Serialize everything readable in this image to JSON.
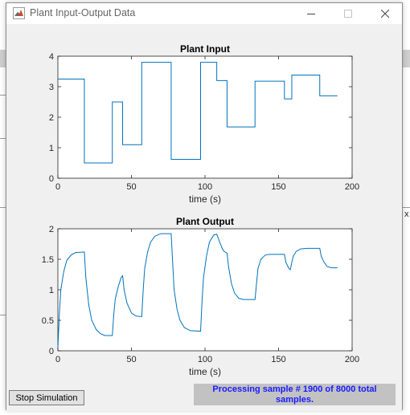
{
  "window": {
    "title": "Plant Input-Output Data",
    "controls": {
      "minimize": "minimize-icon",
      "maximize": "maximize-icon",
      "close": "close-icon"
    }
  },
  "status_text": "Processing sample # 1900 of 8000 total samples.",
  "stop_label": "Stop Simulation",
  "colors": {
    "line": "#0072bd",
    "status_text": "#1a1aff",
    "status_bg": "#c2c2c2"
  },
  "chart_data": [
    {
      "type": "line",
      "title": "Plant Input",
      "xlabel": "time (s)",
      "ylabel": "",
      "xlim": [
        0,
        200
      ],
      "ylim": [
        0,
        4
      ],
      "xticks": [
        0,
        50,
        100,
        150,
        200
      ],
      "yticks": [
        0,
        1,
        2,
        3,
        4
      ],
      "ytick_labels": [
        "0",
        "1",
        "2",
        "3",
        "4"
      ],
      "grid": false,
      "series": [
        {
          "step": true,
          "x": [
            0,
            18,
            37,
            44,
            57,
            77,
            97,
            108,
            115,
            134,
            154,
            159,
            178,
            190
          ],
          "y": [
            3.25,
            0.5,
            2.5,
            1.1,
            3.8,
            0.62,
            3.8,
            3.2,
            1.68,
            3.18,
            2.6,
            3.38,
            2.7,
            2.7
          ]
        }
      ]
    },
    {
      "type": "line",
      "title": "Plant Output",
      "xlabel": "time (s)",
      "ylabel": "",
      "xlim": [
        0,
        200
      ],
      "ylim": [
        0,
        2
      ],
      "xticks": [
        0,
        50,
        100,
        150,
        200
      ],
      "yticks": [
        0,
        0.5,
        1,
        1.5,
        2
      ],
      "ytick_labels": [
        "0",
        "0.5",
        "1",
        "1.5",
        "2"
      ],
      "grid": false,
      "series": [
        {
          "x": [
            0,
            1,
            2,
            4,
            6,
            9,
            12,
            18,
            19,
            21,
            23,
            26,
            29,
            32,
            37,
            38,
            39,
            41,
            43,
            44,
            45,
            47,
            50,
            53,
            57,
            58,
            59,
            61,
            63,
            66,
            70,
            77,
            78,
            79,
            81,
            83,
            86,
            90,
            97,
            98,
            99,
            101,
            103,
            106,
            108,
            110,
            112,
            113,
            115,
            116,
            118,
            120,
            123,
            126,
            130,
            134,
            135,
            136,
            138,
            141,
            144,
            149,
            154,
            155,
            157,
            158,
            159,
            160,
            162,
            165,
            170,
            178,
            179,
            181,
            183,
            186,
            190
          ],
          "y": [
            0.05,
            0.6,
            1.0,
            1.3,
            1.48,
            1.57,
            1.61,
            1.62,
            1.2,
            0.75,
            0.5,
            0.35,
            0.28,
            0.25,
            0.25,
            0.6,
            0.85,
            1.05,
            1.2,
            1.23,
            1.0,
            0.78,
            0.62,
            0.57,
            0.56,
            1.0,
            1.35,
            1.62,
            1.78,
            1.88,
            1.92,
            1.92,
            1.45,
            1.0,
            0.68,
            0.5,
            0.38,
            0.33,
            0.32,
            0.82,
            1.2,
            1.55,
            1.78,
            1.9,
            1.91,
            1.78,
            1.66,
            1.63,
            1.6,
            1.38,
            1.1,
            0.95,
            0.86,
            0.84,
            0.84,
            0.84,
            1.1,
            1.35,
            1.5,
            1.57,
            1.58,
            1.58,
            1.58,
            1.45,
            1.35,
            1.33,
            1.45,
            1.55,
            1.63,
            1.67,
            1.68,
            1.68,
            1.55,
            1.45,
            1.38,
            1.36,
            1.36
          ]
        }
      ]
    }
  ]
}
